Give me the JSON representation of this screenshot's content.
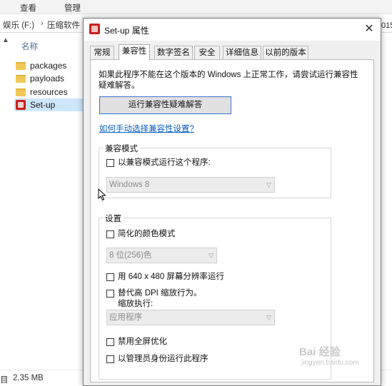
{
  "explorer": {
    "ribbon_tabs": [
      "查看",
      "管理"
    ],
    "breadcrumb": [
      "娱乐 (F:)",
      "压缩软件"
    ],
    "breadcrumb_right_fragment": "015",
    "column_header": "名称",
    "files": [
      {
        "name": "packages",
        "type": "folder"
      },
      {
        "name": "payloads",
        "type": "folder"
      },
      {
        "name": "resources",
        "type": "folder"
      },
      {
        "name": "Set-up",
        "type": "app",
        "selected": true
      }
    ],
    "status_left": "目",
    "status_size": "2.35 MB"
  },
  "dialog": {
    "title": "Set-up 属性",
    "close_glyph": "✕",
    "tabs": [
      {
        "label": "常规",
        "active": false
      },
      {
        "label": "兼容性",
        "active": true
      },
      {
        "label": "数字签名",
        "active": false
      },
      {
        "label": "安全",
        "active": false
      },
      {
        "label": "详细信息",
        "active": false
      },
      {
        "label": "以前的版本",
        "active": false
      }
    ],
    "intro_text": "如果此程序不能在这个版本的 Windows 上正常工作，请尝试运行兼容性疑难解答。",
    "troubleshoot_button": "运行兼容性疑难解答",
    "manual_link": "如何手动选择兼容性设置?",
    "compat_mode": {
      "group_label": "兼容模式",
      "checkbox_label": "以兼容模式运行这个程序:",
      "checked": false,
      "os_select": "Windows 8"
    },
    "settings": {
      "group_label": "设置",
      "reduced_color_label": "简化的颜色模式",
      "reduced_color_checked": false,
      "color_select": "8 位(256)色",
      "res_640_label": "用 640 x 480 屏幕分辨率运行",
      "res_640_checked": false,
      "dpi_label": "替代高 DPI 缩放行为。",
      "dpi_sub_label": "缩放执行:",
      "dpi_checked": false,
      "dpi_select": "应用程序",
      "fullscreen_opt_label": "禁用全屏优化",
      "fullscreen_opt_checked": false,
      "admin_label": "以管理员身份运行此程序",
      "admin_checked": false
    }
  },
  "watermark": {
    "text": "Bai 经验",
    "sub": "jingyan.baidu.com"
  },
  "colors": {
    "accent_button_border": "#3c78d8",
    "link": "#0b5fc4",
    "selection": "#cde6fb",
    "app_icon": "#c9201d"
  }
}
